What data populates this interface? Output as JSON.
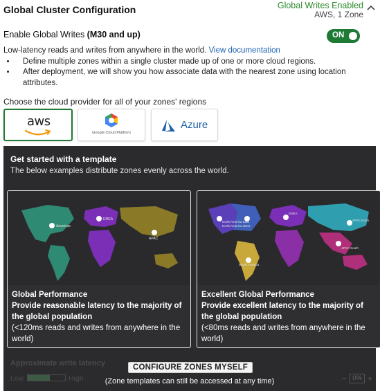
{
  "header": {
    "title": "Global Cluster Configuration",
    "status_enabled": "Global Writes Enabled",
    "status_detail": "AWS, 1 Zone"
  },
  "enable": {
    "label": "Enable Global Writes",
    "tier": "(M30 and up)",
    "toggle_label": "ON",
    "toggle_on": true
  },
  "description": {
    "intro": "Low-latency reads and writes from anywhere in the world.",
    "link": "View documentation",
    "bullets": [
      "Define multiple zones within a single cluster made up of one or more cloud regions.",
      "After deployment, we will show you how associate data with the nearest zone using location attributes."
    ]
  },
  "providers": {
    "label": "Choose the cloud provider for all of your zones' regions",
    "aws": "aws",
    "gcp": "Google Cloud Platform",
    "azure": "Azure",
    "selected": "aws"
  },
  "templates": {
    "title": "Get started with a template",
    "subtitle": "The below examples distribute zones evenly across the world.",
    "cards": [
      {
        "name": "Global Performance",
        "headline": "Provide reasonable latency to the majority of the global population",
        "detail": "(<120ms reads and writes from anywhere in the world)",
        "map_labels": [
          "Americas",
          "EMEA",
          "APAC"
        ]
      },
      {
        "name": "Excellent Global Performance",
        "headline": "Provide excellent latency to the majority of the global population",
        "detail": "(<80ms reads and writes from anywhere in the world)",
        "map_labels": [
          "North America East",
          "North America West",
          "EMEA",
          "APAC North",
          "APAC South",
          "South America"
        ]
      }
    ],
    "latency_label": "Approximate write latency",
    "latency_low": "Low",
    "latency_high": "High",
    "latency_level": 0.6,
    "configure_button": "CONFIGURE ZONES MYSELF",
    "configure_note": "(Zone templates can still be accessed at any time)",
    "zoom_value": "0%"
  },
  "colors": {
    "green": "#1e7a34",
    "link": "#1a5fb0",
    "panel": "#2b2b2d",
    "azure": "#1d5fa8",
    "aws_smile": "#f39c12"
  }
}
